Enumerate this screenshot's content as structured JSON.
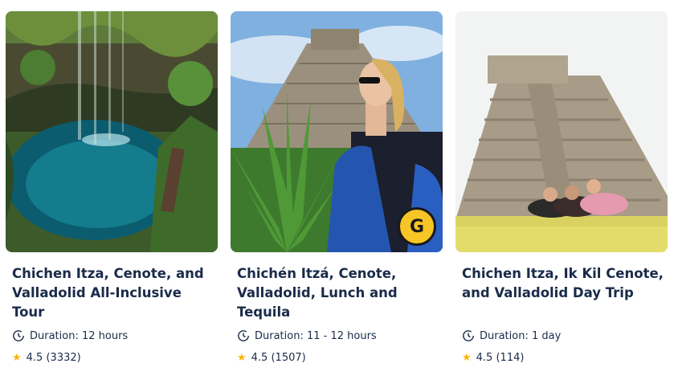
{
  "cards": [
    {
      "title": "Chichen Itza, Cenote, and Valladolid All-Inclusive Tour",
      "duration": "Duration: 12 hours",
      "rating": "4.5",
      "reviews": "(3332)",
      "image": "cenote-photo"
    },
    {
      "title": "Chichén Itzá, Cenote, Valladolid, Lunch and Tequila",
      "duration": "Duration: 11 - 12 hours",
      "rating": "4.5",
      "reviews": "(1507)",
      "image": "pyramid-woman-photo",
      "badge": "G"
    },
    {
      "title": "Chichen Itza, Ik Kil Cenote, and Valladolid Day Trip",
      "duration": "Duration: 1 day",
      "rating": "4.5",
      "reviews": "(114)",
      "image": "pyramid-lawn-photo"
    }
  ],
  "icons": {
    "clock": "clock-icon",
    "star": "star-icon"
  },
  "colors": {
    "text": "#1a2b49",
    "star": "#ffb400",
    "badge": "#f7c525"
  }
}
